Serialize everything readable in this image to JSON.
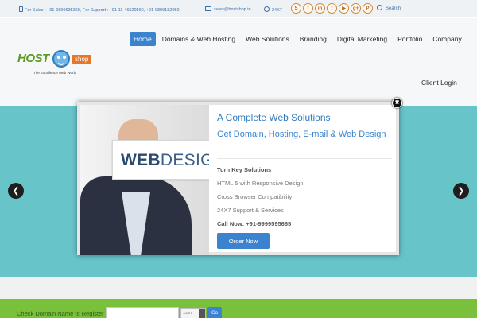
{
  "topbar": {
    "contact": "For Sales : +91-9899635360, For Support : +91-11-46520560, +91-9899182050",
    "email": "sales@hostshop.in",
    "hours": "24X7",
    "socials": [
      "S",
      "f",
      "in",
      "t",
      "▶",
      "g+",
      "P"
    ],
    "search_label": "Search"
  },
  "logo": {
    "host": "HOST",
    "shop": "shop",
    "tagline": "The Excellence Web World"
  },
  "nav": {
    "items": [
      "Home",
      "Domains & Web Hosting",
      "Web Solutions",
      "Branding",
      "Digital Marketing",
      "Portfolio",
      "Company"
    ],
    "client_login": "Client Login"
  },
  "slider": {
    "prev": "❮",
    "next": "❯"
  },
  "modal": {
    "image_card_bold": "WEB",
    "image_card_rest": "DESIGN",
    "title": "A Complete Web Solutions",
    "subtitle": "Get Domain, Hosting, E-mail & Web Design",
    "key_heading": "Turn Key Solutions",
    "features": [
      "HTML 5 with Responsive Design",
      "Cross Browser Compatibility",
      "24X7 Support & Services"
    ],
    "call_label": "Call Now:",
    "call_number": "+91-9999595665",
    "order_button": "Order Now",
    "close": "✖"
  },
  "domain_bar": {
    "label": "Check Domain Name to Register",
    "select_value": ".com",
    "go": "Go"
  },
  "colors": {
    "accent": "#3b83cf",
    "slider_bg": "#67c4c9",
    "domain_bar_bg": "#79c13a"
  }
}
